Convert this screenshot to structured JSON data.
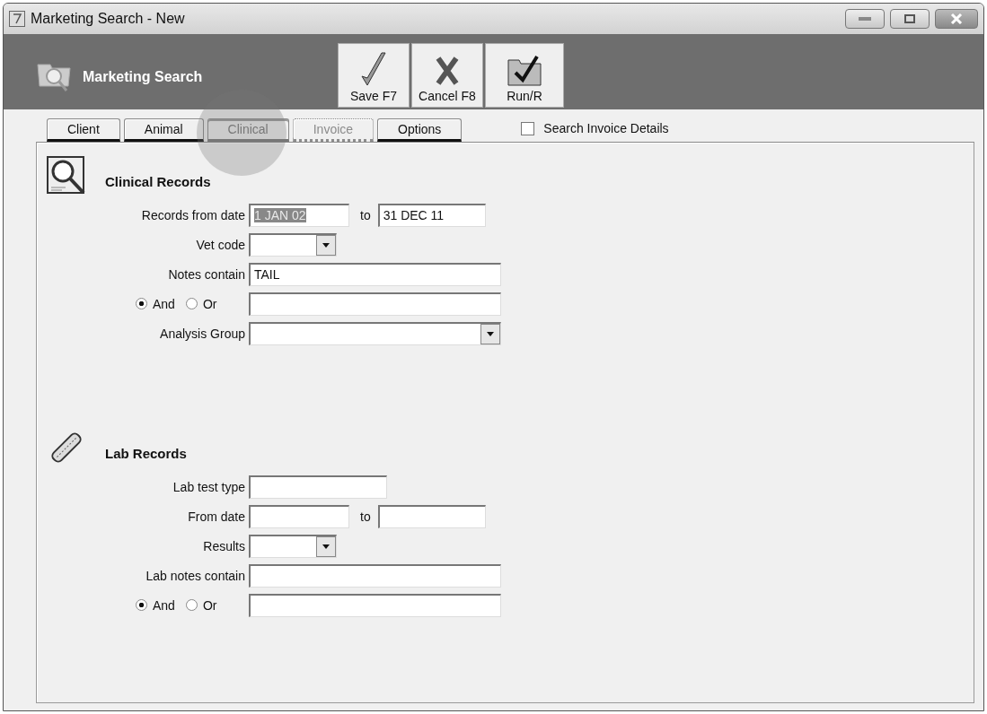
{
  "window": {
    "title": "Marketing Search - New"
  },
  "header": {
    "title": "Marketing Search"
  },
  "toolbar": [
    {
      "label": "Save F7",
      "kind": "save"
    },
    {
      "label": "Cancel F8",
      "kind": "cancel"
    },
    {
      "label": "Run/R",
      "kind": "run"
    }
  ],
  "tabs": [
    {
      "label": "Client",
      "selected": false,
      "disabled": false
    },
    {
      "label": "Animal",
      "selected": false,
      "disabled": false
    },
    {
      "label": "Clinical",
      "selected": true,
      "disabled": false
    },
    {
      "label": "Invoice",
      "selected": false,
      "disabled": true
    },
    {
      "label": "Options",
      "selected": false,
      "disabled": false
    }
  ],
  "search_invoice_details": {
    "label": "Search Invoice Details",
    "checked": false
  },
  "sections": [
    {
      "kind": "clinical",
      "title": "Clinical Records",
      "rows": [
        {
          "kind": "date_range",
          "label": "Records from date",
          "from_value": "1 JAN 02",
          "highlighted": true,
          "to_label": "to",
          "to_value": "31 DEC 11"
        },
        {
          "kind": "dropdown_short",
          "label": "Vet code"
        },
        {
          "kind": "text_long",
          "label": "Notes contain",
          "value": "TAIL"
        },
        {
          "kind": "andor",
          "options": [
            {
              "label": "And",
              "selected": true
            },
            {
              "label": "Or",
              "selected": false
            }
          ]
        },
        {
          "kind": "dropdown_long",
          "label": "Analysis Group"
        }
      ]
    },
    {
      "kind": "lab",
      "title": "Lab Records",
      "rows": [
        {
          "kind": "text_medium",
          "label": "Lab test type"
        },
        {
          "kind": "date_range",
          "label": "From date",
          "to_label": "to"
        },
        {
          "kind": "dropdown_short",
          "label": "Results"
        },
        {
          "kind": "text_long",
          "label": "Lab notes contain"
        },
        {
          "kind": "andor",
          "options": [
            {
              "label": "And",
              "selected": true
            },
            {
              "label": "Or",
              "selected": false
            }
          ]
        }
      ]
    }
  ]
}
